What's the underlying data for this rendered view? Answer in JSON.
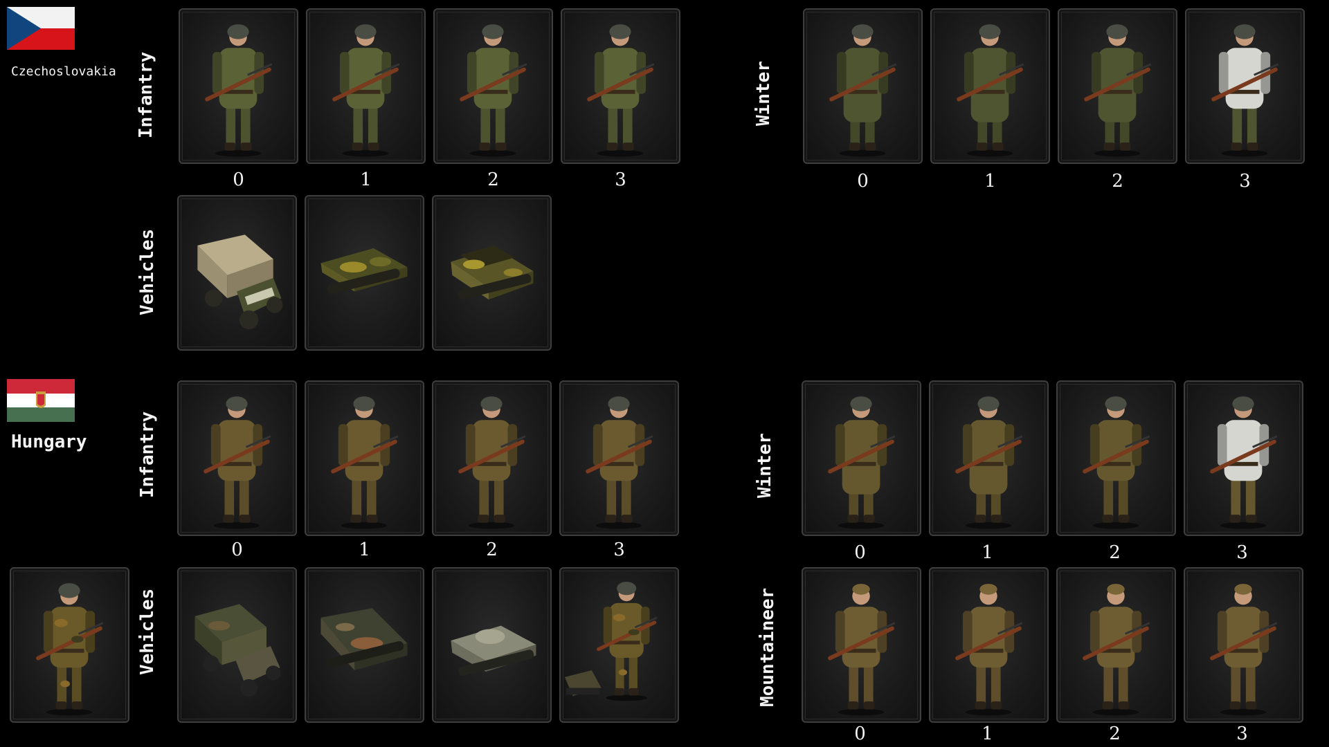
{
  "factions": [
    {
      "name": "Czechoslovakia",
      "flag_colors": {
        "top": "#f2f2f2",
        "bottom": "#d7141a",
        "triangle": "#11457e"
      },
      "rows": {
        "infantry": {
          "label": "Infantry",
          "indices": [
            "0",
            "1",
            "2",
            "3"
          ],
          "uniform": "#5a6236"
        },
        "winter": {
          "label": "Winter",
          "indices": [
            "0",
            "1",
            "2",
            "3"
          ],
          "uniform": "#4f5530"
        },
        "vehicles": {
          "label": "Vehicles",
          "items": [
            "truck-icon",
            "halftrack-icon",
            "tankette-icon"
          ]
        }
      }
    },
    {
      "name": "Hungary",
      "flag_colors": {
        "top": "#ce2939",
        "middle": "#ffffff",
        "bottom": "#477050"
      },
      "rows": {
        "infantry": {
          "label": "Infantry",
          "indices": [
            "0",
            "1",
            "2",
            "3"
          ],
          "uniform": "#6b5a30"
        },
        "winter": {
          "label": "Winter",
          "indices": [
            "0",
            "1",
            "2",
            "3"
          ],
          "uniform": "#66582e"
        },
        "vehicles": {
          "label": "Vehicles",
          "items": [
            "truck-icon",
            "halftrack-icon",
            "tank-icon",
            "crew-icon"
          ]
        },
        "mountaineer": {
          "label": "Mountaineer",
          "indices": [
            "0",
            "1",
            "2",
            "3"
          ],
          "uniform": "#6e5c33"
        }
      }
    }
  ]
}
